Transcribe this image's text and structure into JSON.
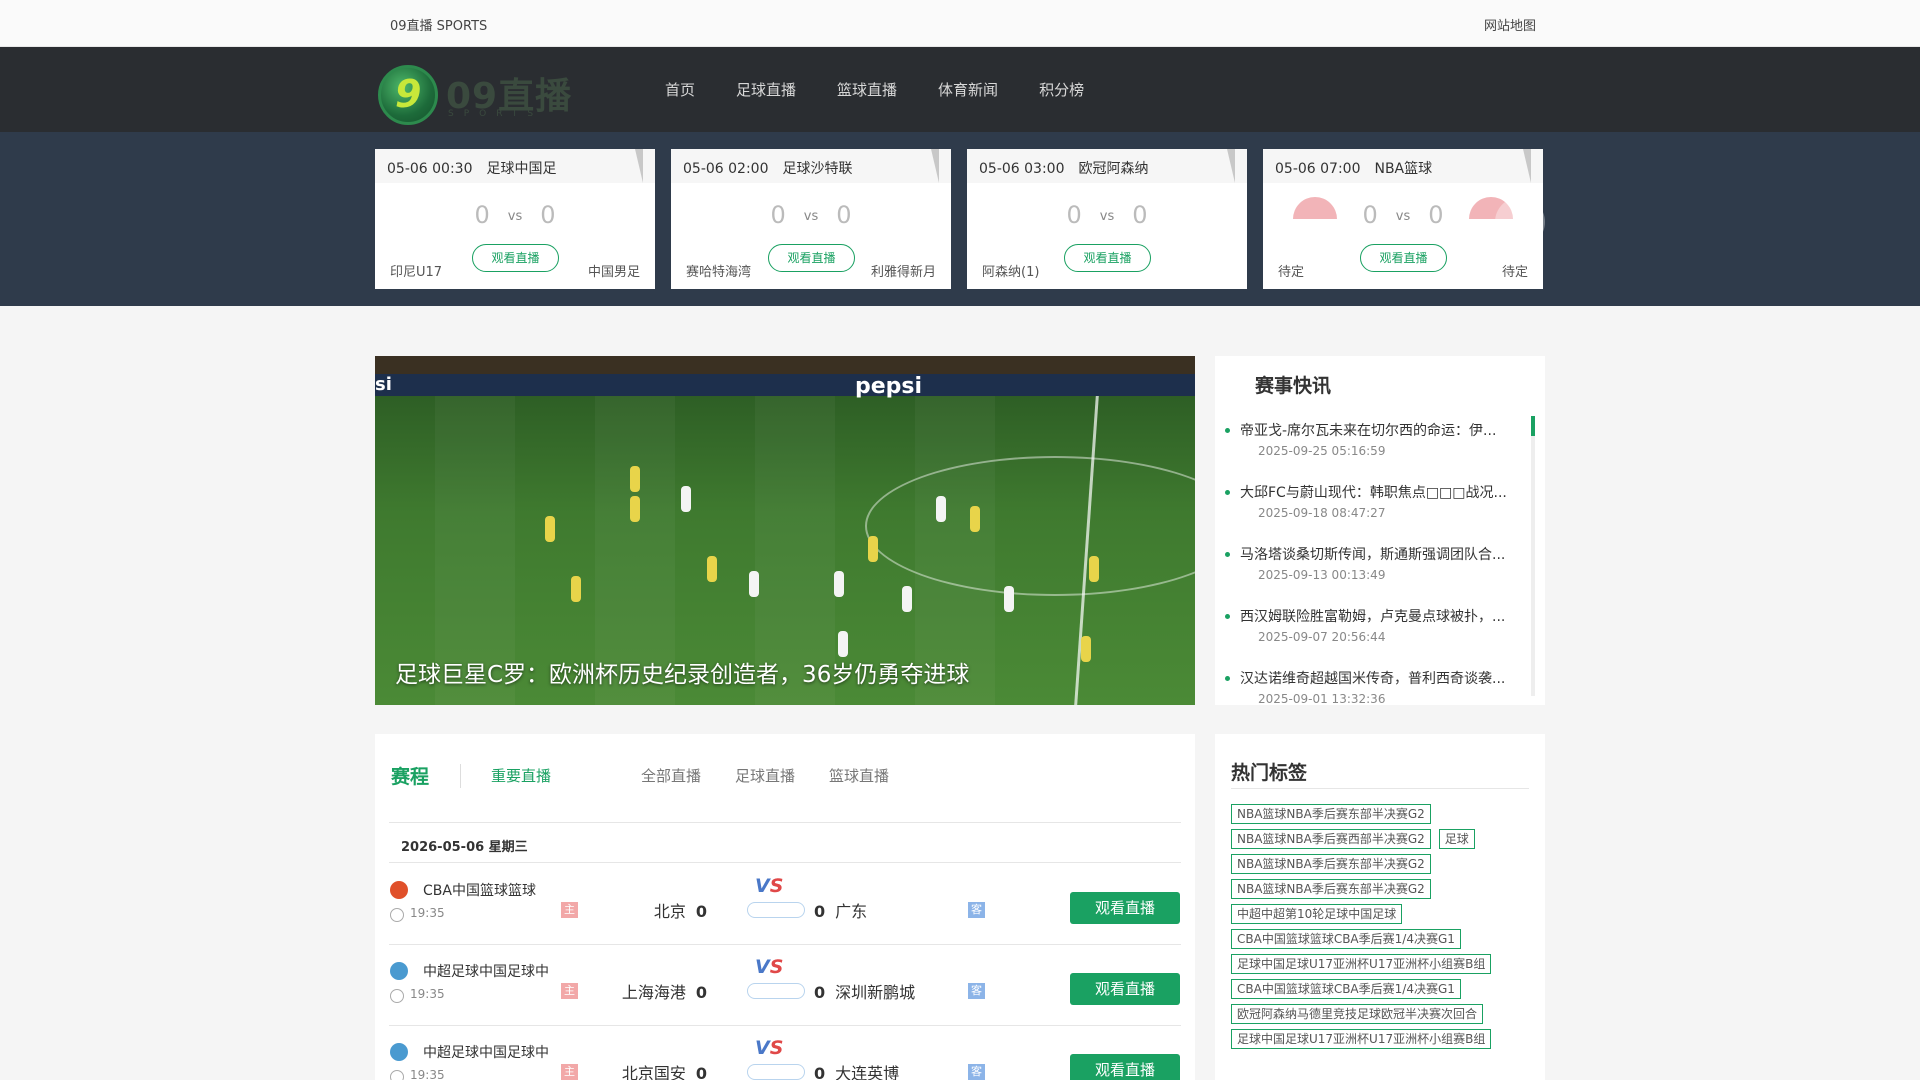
{
  "topbar": {
    "brand": "09直播 SPORTS",
    "sitemap": "网站地图"
  },
  "logo": {
    "mark": "9",
    "text": "09直播",
    "sub": "SPORTS"
  },
  "nav": [
    "首页",
    "足球直播",
    "篮球直播",
    "体育新闻",
    "积分榜"
  ],
  "matches": [
    {
      "time": "05-06 00:30",
      "title": "足球中国足",
      "home": "印尼U17",
      "away": "中国男足",
      "home_score": "0",
      "away_score": "0",
      "vs": "vs",
      "watch": "观看直播",
      "flags": false
    },
    {
      "time": "05-06 02:00",
      "title": "足球沙特联",
      "home": "赛哈特海湾",
      "away": "利雅得新月",
      "home_score": "0",
      "away_score": "0",
      "vs": "vs",
      "watch": "观看直播",
      "flags": false
    },
    {
      "time": "05-06 03:00",
      "title": "欧冠阿森纳",
      "home": "阿森纳(1)",
      "away": "",
      "home_score": "0",
      "away_score": "0",
      "vs": "vs",
      "watch": "观看直播",
      "flags": false
    },
    {
      "time": "05-06 07:00",
      "title": "NBA篮球",
      "home": "待定",
      "away": "待定",
      "home_score": "0",
      "away_score": "0",
      "vs": "vs",
      "watch": "观看直播",
      "flags": true
    }
  ],
  "arrows": {
    "prev": "‹",
    "next": "›"
  },
  "hero": {
    "caption": "足球巨星C罗：欧洲杯历史纪录创造者，36岁仍勇夺进球",
    "ad1": "si",
    "ad2": "pepsi"
  },
  "news": {
    "title": "赛事快讯",
    "items": [
      {
        "title": "帝亚戈-席尔瓦未来在切尔西的命运：伊...",
        "date": "2025-09-25 05:16:59"
      },
      {
        "title": "大邱FC与蔚山现代：韩职焦点□□□战况...",
        "date": "2025-09-18 08:47:27"
      },
      {
        "title": "马洛塔谈桑切斯传闻，斯通斯强调团队合...",
        "date": "2025-09-13 00:13:49"
      },
      {
        "title": "西汉姆联险胜富勒姆，卢克曼点球被扑，...",
        "date": "2025-09-07 20:56:44"
      },
      {
        "title": "汉达诺维奇超越国米传奇，普利西奇谈袭...",
        "date": "2025-09-01 13:32:36"
      }
    ]
  },
  "schedule": {
    "title": "赛程",
    "tabs": [
      "重要直播",
      "全部直播",
      "足球直播",
      "篮球直播"
    ],
    "date": "2026-05-06 星期三",
    "home_mark": "主",
    "away_mark": "客",
    "vs_v": "V",
    "vs_s": "S",
    "rows": [
      {
        "league": "CBA中国篮球篮球",
        "time": "19:35",
        "home": "北京",
        "home_score": "0",
        "away": "广东",
        "away_score": "0",
        "button": "观看直播",
        "icon_color": "#e0502a"
      },
      {
        "league": "中超足球中国足球中",
        "time": "19:35",
        "home": "上海海港",
        "home_score": "0",
        "away": "深圳新鹏城",
        "away_score": "0",
        "button": "观看直播",
        "icon_color": "#4a9ad0"
      },
      {
        "league": "中超足球中国足球中",
        "time": "19:35",
        "home": "北京国安",
        "home_score": "0",
        "away": "大连英博",
        "away_score": "0",
        "button": "观看直播",
        "icon_color": "#4a9ad0"
      }
    ]
  },
  "tags": {
    "title": "热门标签",
    "items": [
      "NBA篮球NBA季后赛东部半决赛G2",
      "NBA篮球NBA季后赛西部半决赛G2",
      "足球",
      "NBA篮球NBA季后赛东部半决赛G2",
      "NBA篮球NBA季后赛东部半决赛G2",
      "中超中超第10轮足球中国足球",
      "CBA中国篮球篮球CBA季后赛1/4决赛G1",
      "足球中国足球U17亚洲杯U17亚洲杯小组赛B组",
      "CBA中国篮球篮球CBA季后赛1/4决赛G1",
      "欧冠阿森纳马德里竞技足球欧冠半决赛次回合",
      "足球中国足球U17亚洲杯U17亚洲杯小组赛B组"
    ]
  },
  "colors": {
    "accent": "#1aa162",
    "nav_bg": "#2a2d31",
    "strip_bg": "#2f3b4b"
  }
}
